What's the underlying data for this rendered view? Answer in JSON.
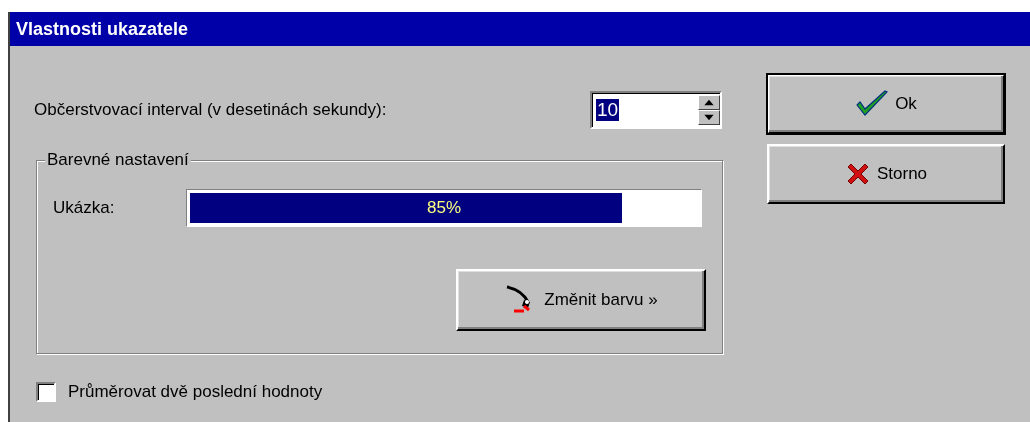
{
  "window": {
    "title": "Vlastnosti ukazatele"
  },
  "interval": {
    "label": "Občerstvovací interval (v desetinách sekundy):",
    "value": "10",
    "selected": true
  },
  "color_group": {
    "title": "Barevné nastavení",
    "preview_label": "Ukázka:",
    "preview": {
      "level": 0.85,
      "reading": "85%"
    },
    "change_button": "Změnit barvu »"
  },
  "average": {
    "label": "Průměrovat dvě poslední hodnoty",
    "checked": false
  },
  "buttons": [
    {
      "kind": "ok",
      "label": "Ok",
      "default": true
    },
    {
      "kind": "cancel",
      "label": "Storno",
      "default": false
    }
  ]
}
